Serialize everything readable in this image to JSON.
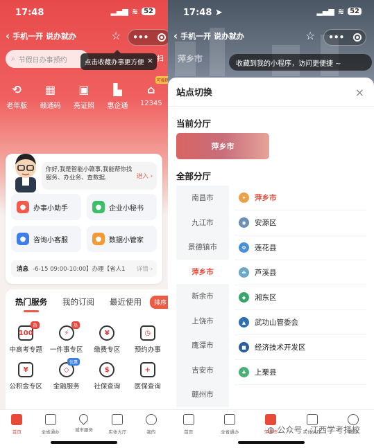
{
  "left": {
    "status": {
      "time": "17:48",
      "signal": "▂▄▆",
      "wifi": "≋",
      "battery": "52"
    },
    "nav": {
      "back_title": "手机一开 说办就办",
      "star": "☆",
      "more": "•••"
    },
    "search": {
      "placeholder": "节假日办事预约",
      "scan_label": "扫"
    },
    "tooltip": {
      "text": "点击收藏办事更方便",
      "close": "×"
    },
    "top_icons": [
      {
        "label": "老年版",
        "glyph": "⟲"
      },
      {
        "label": "赣通码",
        "glyph": "▦"
      },
      {
        "label": "亮证照",
        "glyph": "▣"
      },
      {
        "label": "惠企通",
        "glyph": "▙"
      },
      {
        "label": "12345",
        "glyph": "⌂",
        "tag": "可援助"
      }
    ],
    "assistant": {
      "greeting": "你好,我是智能小赣事,我能帮你找服务、办业务、查数据.",
      "enter": "进入 ›",
      "tiles": [
        {
          "label": "办事小助手",
          "color": "#f15b4e",
          "glyph": "●"
        },
        {
          "label": "企业小秘书",
          "color": "#3fbf6a",
          "glyph": "●"
        },
        {
          "label": "咨询小客服",
          "color": "#3f7ee8",
          "glyph": "●"
        },
        {
          "label": "数据小管家",
          "color": "#f29a38",
          "glyph": "●"
        }
      ],
      "message_label": "消息",
      "message_text": "-6-15 09:00-10:00】办理【省人1",
      "message_more": "详情 ›"
    },
    "services": {
      "tabs": [
        "热门服务",
        "我的订阅",
        "最近使用"
      ],
      "sort_button": "排序",
      "items": [
        {
          "label": "中高考专题",
          "glyph": "100",
          "badge": "热",
          "badge_color": "red"
        },
        {
          "label": "一件事专区",
          "glyph": "⚡",
          "badge": "热",
          "badge_color": "red",
          "round": true
        },
        {
          "label": "缴费专区",
          "glyph": "¥",
          "round": true
        },
        {
          "label": "预约办事",
          "glyph": "◷"
        },
        {
          "label": "公积金专区",
          "glyph": "¥"
        },
        {
          "label": "金融服务",
          "glyph": "◇",
          "badge": "优惠",
          "badge_color": "blue",
          "round": true
        },
        {
          "label": "社保查询",
          "glyph": "$",
          "round": true
        },
        {
          "label": "医保查询",
          "glyph": "+"
        }
      ]
    },
    "tabbar": [
      {
        "label": "首页",
        "active": true,
        "shape": "square"
      },
      {
        "label": "全省通办",
        "active": false,
        "shape": "square"
      },
      {
        "label": "城市服务",
        "active": false,
        "shape": "round"
      },
      {
        "label": "实体大厅",
        "active": false,
        "shape": "square"
      },
      {
        "label": "我的",
        "active": false,
        "shape": "circ"
      }
    ]
  },
  "right": {
    "status": {
      "time": "17:48 ➤",
      "signal": "▂▄▆",
      "wifi": "≋",
      "battery": "52"
    },
    "nav": {
      "back_title": "手机一开 说办就办",
      "star": "☆",
      "more": "•••"
    },
    "bg_city": "萍乡市",
    "toast": "收藏到我的小程序，访问更便捷 ~",
    "sheet": {
      "title": "站点切换",
      "close": "×",
      "current_section": "当前分厅",
      "current_city": "萍乡市",
      "all_section": "全部分厅",
      "cities": [
        "南昌市",
        "九江市",
        "景德镇市",
        "萍乡市",
        "新余市",
        "上饶市",
        "鹰潭市",
        "吉安市",
        "赣州市"
      ],
      "active_city": "萍乡市",
      "districts": [
        {
          "label": "萍乡市",
          "active": true,
          "color": "#e8a24a",
          "glyph": "✦"
        },
        {
          "label": "安源区",
          "active": false,
          "color": "#6b8fb3",
          "glyph": "◉"
        },
        {
          "label": "莲花县",
          "active": false,
          "color": "#4a90d9",
          "glyph": "✿"
        },
        {
          "label": "芦溪县",
          "active": false,
          "color": "#6aa7c9",
          "glyph": "☘"
        },
        {
          "label": "湘东区",
          "active": false,
          "color": "#3aa56b",
          "glyph": "◆"
        },
        {
          "label": "武功山管委会",
          "active": false,
          "color": "#2f6db5",
          "glyph": "▲"
        },
        {
          "label": "经济技术开发区",
          "active": false,
          "color": "#2b5c9e",
          "glyph": "■"
        },
        {
          "label": "上栗县",
          "active": false,
          "color": "#4caf78",
          "glyph": "♣"
        }
      ]
    },
    "tabbar": [
      {
        "label": "首页",
        "active": false,
        "shape": "square"
      },
      {
        "label": "全省通办",
        "active": false,
        "shape": "square"
      },
      {
        "label": "萍乡市",
        "active": true,
        "shape": "square"
      },
      {
        "label": "实体大厅",
        "active": false,
        "shape": "square"
      },
      {
        "label": "我的",
        "active": false,
        "shape": "circ"
      }
    ],
    "watermark": "公众号 · 江西学考择校"
  }
}
